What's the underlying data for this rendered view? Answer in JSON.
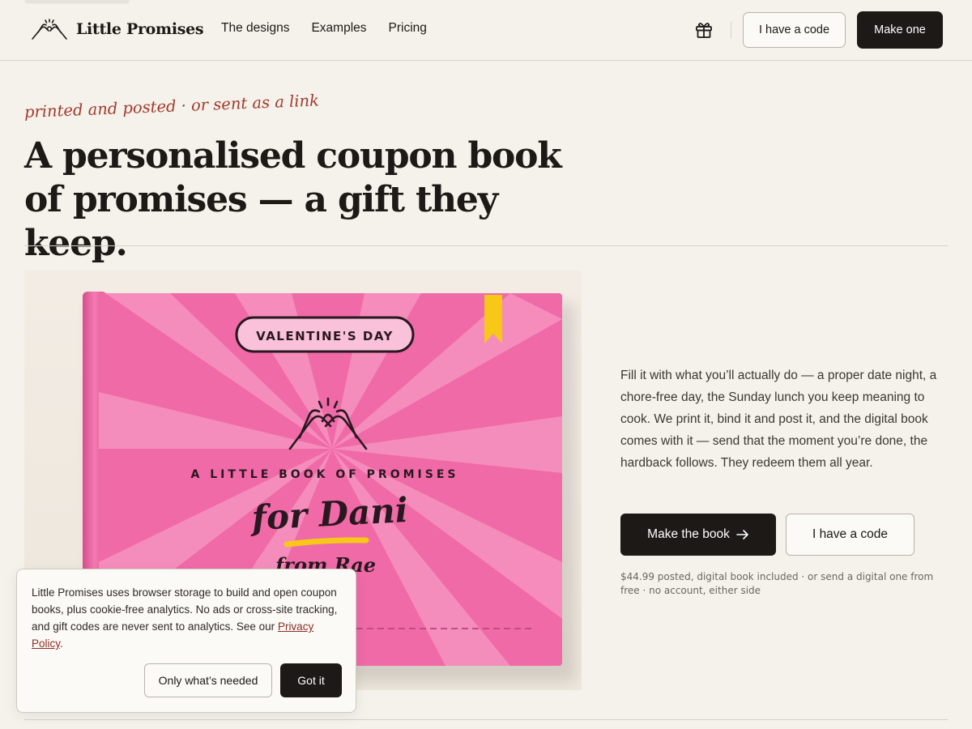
{
  "brand": {
    "name": "Little Promises"
  },
  "nav": {
    "items": [
      "The designs",
      "Examples",
      "Pricing"
    ]
  },
  "header": {
    "gift_icon": "gift-icon",
    "code_label": "I have a code",
    "make_label": "Make one"
  },
  "hero": {
    "tagline": "printed and posted · or sent as a link",
    "headline_line1": "A personalised coupon book",
    "headline_line2": "of promises — a gift they keep."
  },
  "book": {
    "occasion": "VALENTINE'S DAY",
    "subtitle": "A LITTLE BOOK OF PROMISES",
    "for_line": "for Dani",
    "from_line": "from Rae",
    "cover_color": "#f06aa8",
    "ribbon_color": "#f7c818"
  },
  "main": {
    "description": "Fill it with what you’ll actually do — a proper date night, a chore-free day, the Sunday lunch you keep meaning to cook. We print it, bind it and post it, and the digital book comes with it — send that the moment you’re done, the hardback follows. They redeem them all year.",
    "make_book_label": "Make the book",
    "arrow_icon": "arrow-right-icon",
    "code_label": "I have a code",
    "fine_print": "$44.99 posted, digital book included · or send a digital one from free · no account, either side"
  },
  "cookie": {
    "text": "Little Promises uses browser storage to build and open coupon books, plus cookie-free analytics. No ads or cross-site tracking, and gift codes are never sent to analytics. See our ",
    "link_label": "Privacy Policy",
    "trailing": ".",
    "needed_label": "Only what’s needed",
    "accept_label": "Got it"
  }
}
